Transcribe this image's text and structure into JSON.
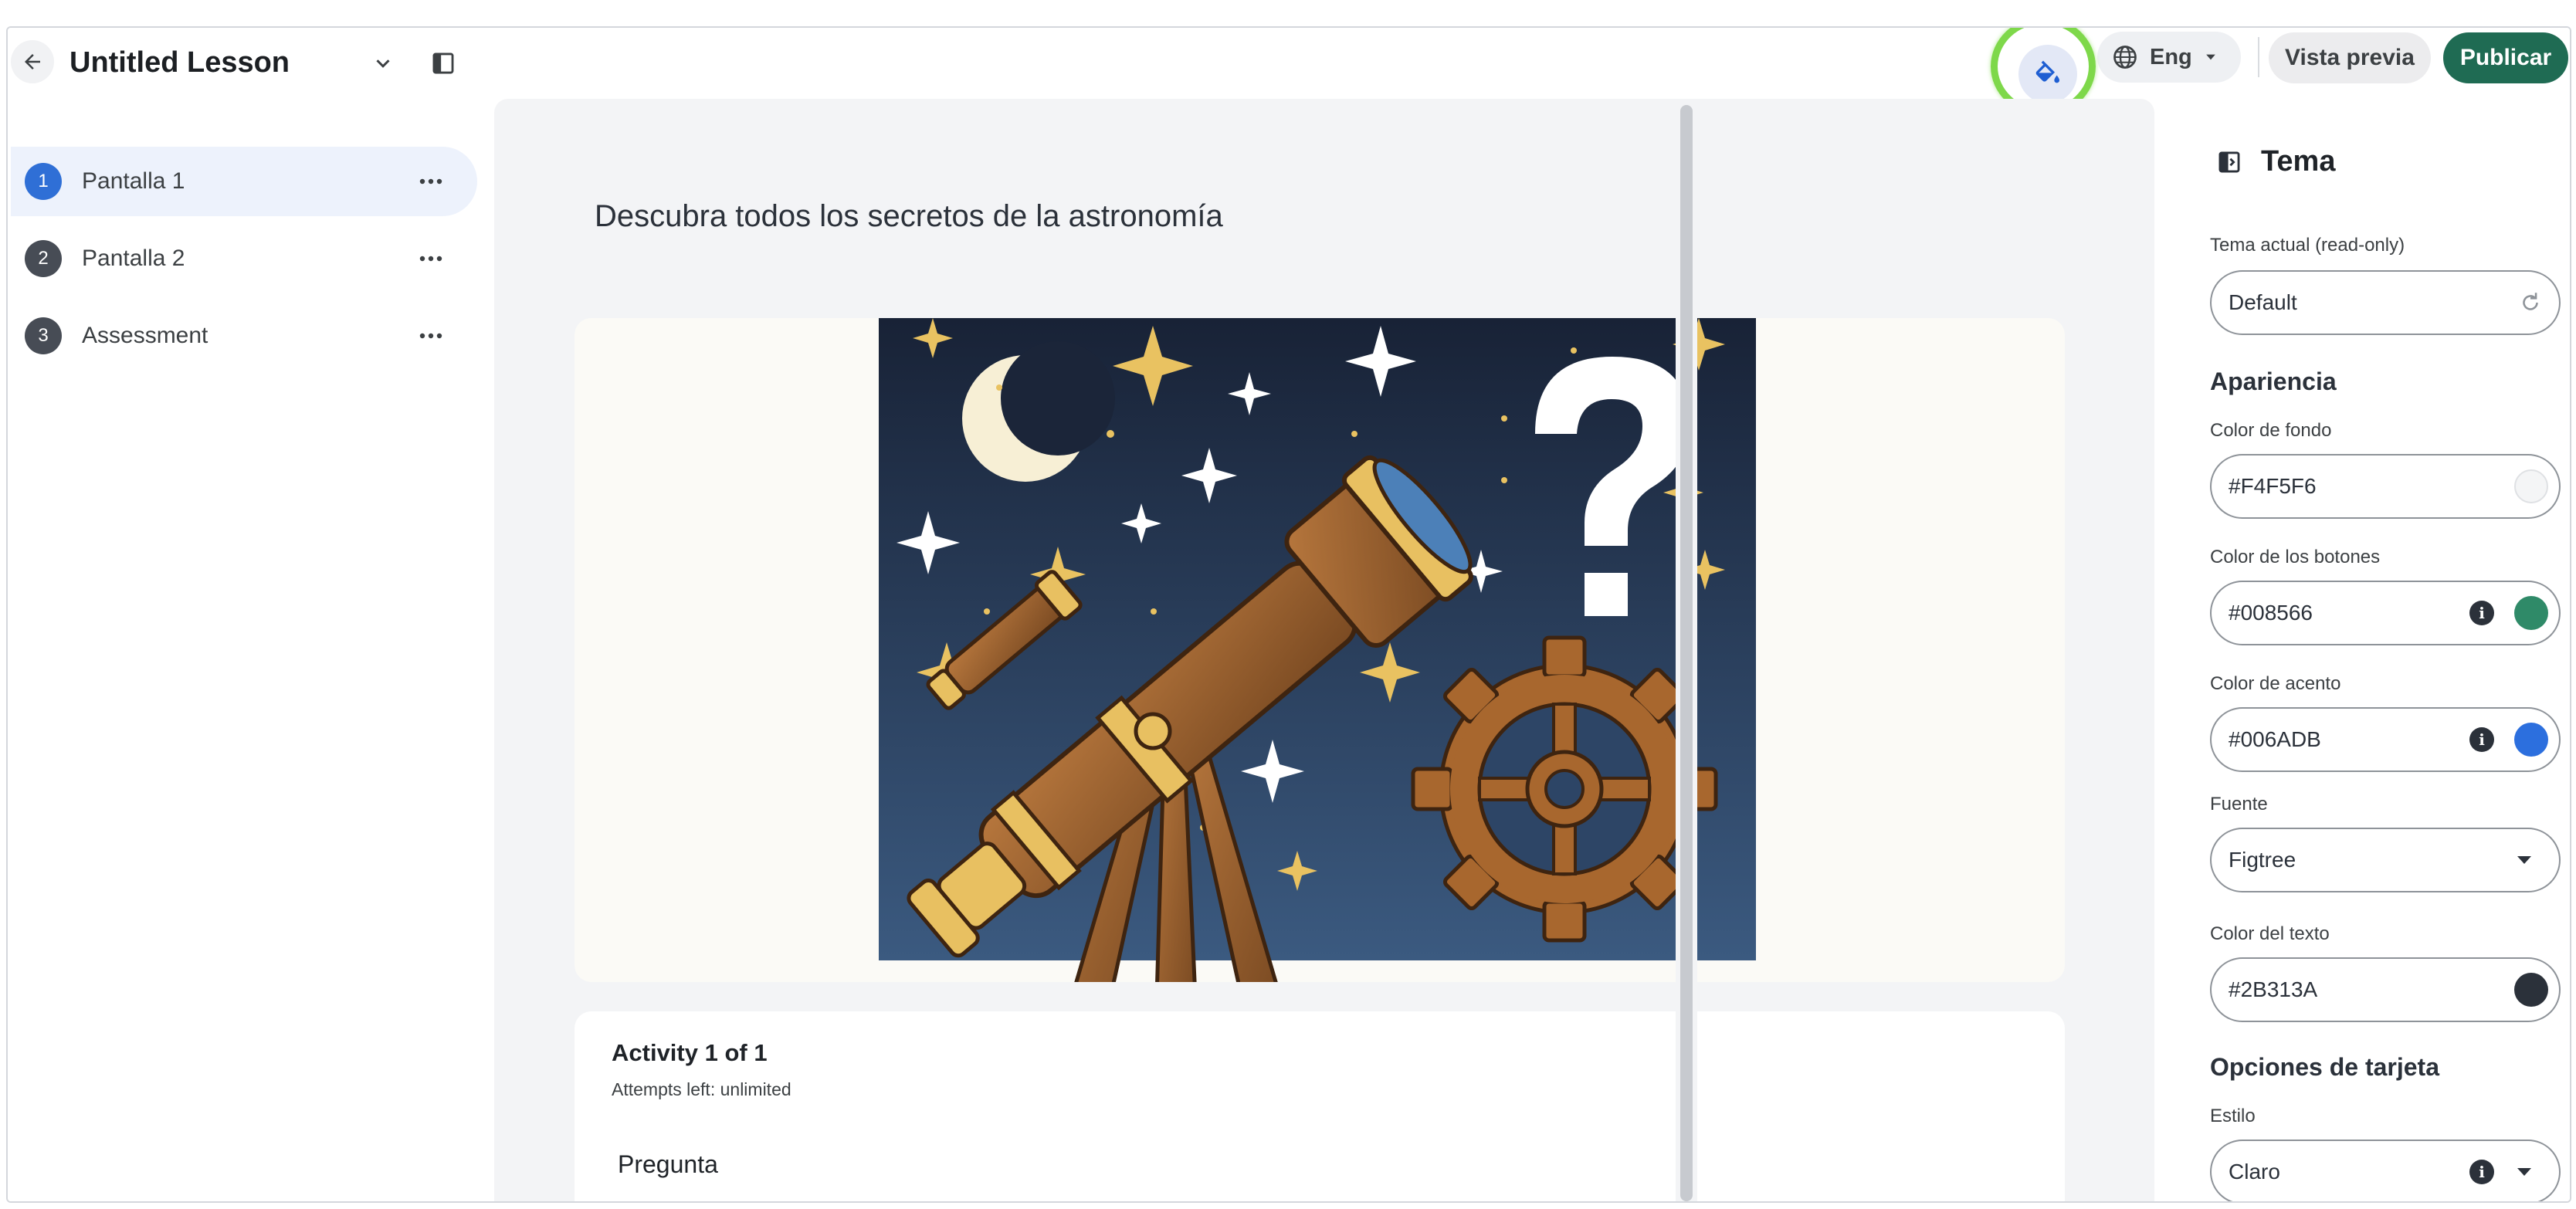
{
  "header": {
    "lesson_title": "Untitled Lesson",
    "language": "Eng",
    "preview_label": "Vista previa",
    "publish_label": "Publicar"
  },
  "sidebar": {
    "items": [
      {
        "number": "1",
        "label": "Pantalla 1",
        "active": true
      },
      {
        "number": "2",
        "label": "Pantalla 2",
        "active": false
      },
      {
        "number": "3",
        "label": "Assessment",
        "active": false
      }
    ]
  },
  "canvas": {
    "heading": "Descubra todos los secretos de la astronomía",
    "activity": {
      "title": "Activity 1 of 1",
      "attempts": "Attempts left: unlimited",
      "question_label": "Pregunta"
    }
  },
  "theme_panel": {
    "title": "Tema",
    "current_theme_label": "Tema actual (read-only)",
    "current_theme_value": "Default",
    "appearance_title": "Apariencia",
    "background_color_label": "Color de fondo",
    "background_color_value": "#F4F5F6",
    "button_color_label": "Color de los botones",
    "button_color_value": "#008566",
    "accent_color_label": "Color de acento",
    "accent_color_value": "#006ADB",
    "font_label": "Fuente",
    "font_value": "Figtree",
    "text_color_label": "Color del texto",
    "text_color_value": "#2B313A",
    "card_options_title": "Opciones de tarjeta",
    "style_label": "Estilo",
    "style_value": "Claro"
  },
  "colors": {
    "publish_button": "#1f6b53",
    "active_screen_badge": "#2f6fd6",
    "highlight_annotation": "#7ed84a",
    "swatch_background": "#f4f5f6",
    "swatch_buttons": "#2f8a68",
    "swatch_accent": "#2c6fde",
    "swatch_text": "#2b313a"
  },
  "icons": {
    "back": "arrow-left-icon",
    "title_dropdown": "chevron-down-icon",
    "panel_toggle": "sidebar-toggle-icon",
    "theme": "paint-bucket-icon",
    "language": "globe-icon",
    "reset_theme": "refresh-icon",
    "info": "info-icon"
  }
}
